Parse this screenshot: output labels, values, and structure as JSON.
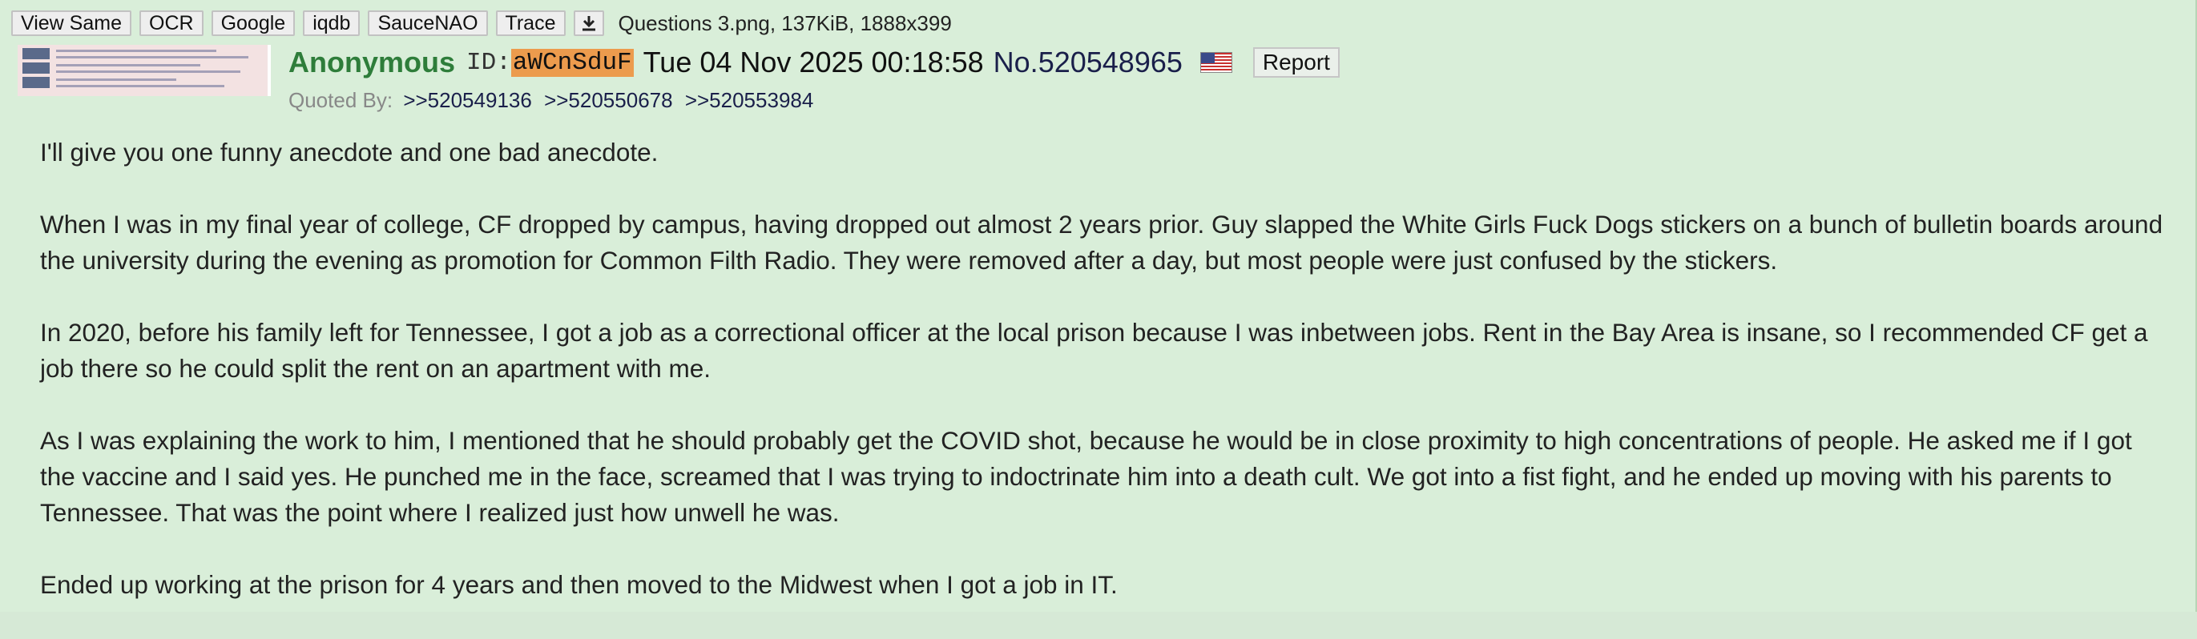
{
  "toolbar": {
    "buttons": [
      "View Same",
      "OCR",
      "Google",
      "iqdb",
      "SauceNAO",
      "Trace"
    ],
    "download_icon": "download-icon",
    "file_info": "Questions 3.png, 137KiB, 1888x399"
  },
  "post": {
    "name": "Anonymous",
    "id_label": "ID:",
    "poster_id": "aWCnSduF",
    "datetime": "Tue 04 Nov 2025 00:18:58",
    "postnum_prefix": "No.",
    "postnum": "520548965",
    "flag_icon": "us-flag-icon",
    "report_label": "Report",
    "quoted_by_label": "Quoted By:",
    "quotes": [
      ">>520549136",
      ">>520550678",
      ">>520553984"
    ],
    "body": [
      "I'll give you one funny anecdote and one bad anecdote.",
      "When I was in my final year of college, CF dropped by campus, having dropped out almost 2 years prior. Guy slapped the White Girls Fuck Dogs stickers on a bunch of bulletin boards around the university during the evening as promotion for Common Filth Radio. They were removed after a day, but most people were just confused by the stickers.",
      "In 2020, before his family left for Tennessee, I got a job as a correctional officer at the local prison because I was inbetween jobs. Rent in the Bay Area is insane, so I recommended CF get a job there so he could split the rent on an apartment with me.",
      "As I was explaining the work to him, I mentioned that he should probably get the COVID shot, because he would be in close proximity to high concentrations of people. He asked me if I got the vaccine and I said yes. He punched me in the face, screamed that I was trying to indoctrinate him into a death cult. We got into a fist fight, and he ended up moving with his parents to Tennessee. That was the point where I realized just how unwell he was.",
      "Ended up working at the prison for 4 years and then moved to the Midwest when I got a job in IT."
    ]
  },
  "colors": {
    "background": "#d9eed9",
    "name": "#2e7d3a",
    "id_highlight": "#ec9b4d",
    "post_link": "#1a1f4a"
  }
}
